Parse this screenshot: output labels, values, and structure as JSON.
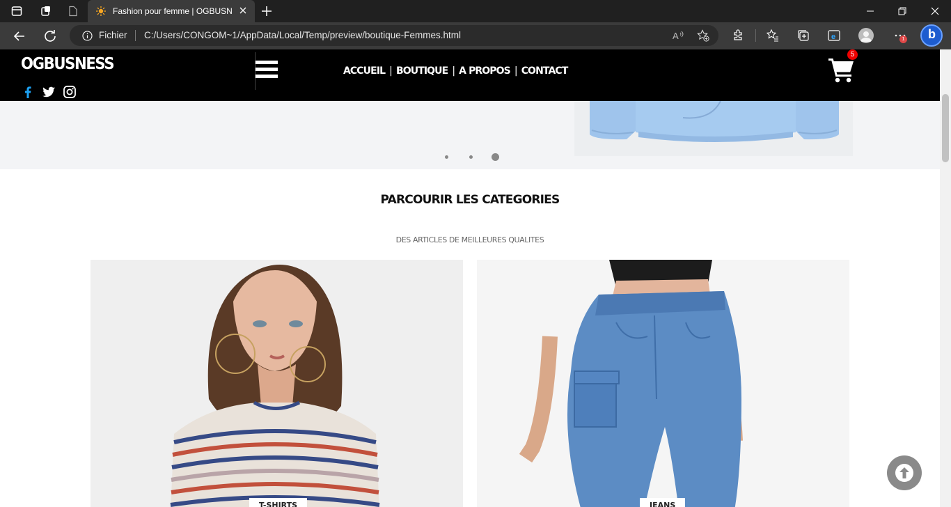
{
  "browser": {
    "tab_title": "Fashion pour femme | OGBUSNESS",
    "url_scheme": "Fichier",
    "url": "C:/Users/CONGOM~1/AppData/Local/Temp/preview/boutique-Femmes.html",
    "notification_count": "1"
  },
  "site": {
    "logo": "OGBUSNESS",
    "nav": [
      "ACCUEIL",
      "BOUTIQUE",
      "A PROPOS",
      "CONTACT"
    ],
    "nav_separator": "|",
    "cart_count": "5",
    "social": [
      "facebook-icon",
      "twitter-icon",
      "instagram-icon"
    ]
  },
  "slider": {
    "dot_count": 3,
    "active_dot": 3
  },
  "categories": {
    "title": "PARCOURIR LES CATEGORIES",
    "subtitle": "DES ARTICLES DE MEILLEURES QUALITES",
    "items": [
      {
        "label": "T-SHIRTS"
      },
      {
        "label": "JEANS"
      }
    ]
  },
  "colors": {
    "header_bg": "#000000",
    "accent_facebook": "#1da1f2",
    "badge": "#ee0000"
  }
}
